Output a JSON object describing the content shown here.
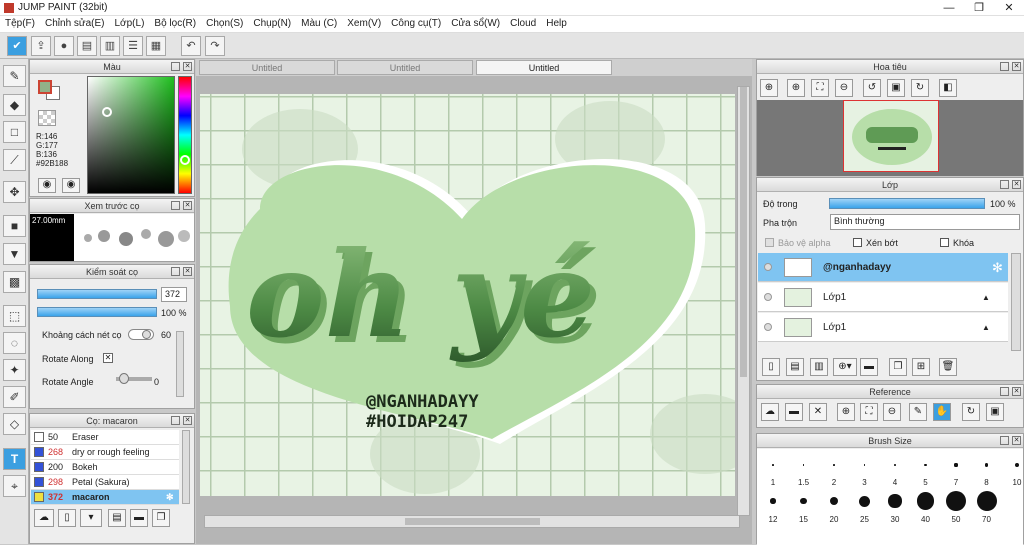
{
  "app": {
    "title": "JUMP PAINT (32bit)"
  },
  "menu": [
    "Tệp(F)",
    "Chỉnh sửa(E)",
    "Lớp(L)",
    "Bộ lọc(R)",
    "Chọn(S)",
    "Chụp(N)",
    "Màu (C)",
    "Xem(V)",
    "Công cụ(T)",
    "Cửa sổ(W)",
    "Cloud",
    "Help"
  ],
  "color_panel": {
    "title": "Màu",
    "r": "R:146",
    "g": "G:177",
    "b": "B:136",
    "hex": "#92B188",
    "main_color": "#92B188"
  },
  "brush_preview": {
    "title": "Xem trước cọ",
    "size": "27.00mm"
  },
  "brush_control": {
    "title": "Kiểm soát cọ",
    "size_value": "372",
    "opacity_value": "100 %",
    "spacing_label": "Khoảng cách nét cọ",
    "spacing_value": "60",
    "rotate_along_label": "Rotate Along",
    "rotate_angle_label": "Rotate Angle",
    "rotate_angle_value": "0"
  },
  "brush_list": {
    "title": "Cọ: macaron",
    "items": [
      {
        "num": "50",
        "name": "Eraser",
        "color": "#ffffff",
        "num_color": "#222222"
      },
      {
        "num": "268",
        "name": "dry or rough feeling",
        "color": "#3352d8",
        "num_color": "#d03030"
      },
      {
        "num": "200",
        "name": "Bokeh",
        "color": "#3352d8",
        "num_color": "#222222"
      },
      {
        "num": "298",
        "name": "Petal (Sakura)",
        "color": "#3352d8",
        "num_color": "#d03030"
      },
      {
        "num": "372",
        "name": "macaron",
        "color": "#f0e040",
        "num_color": "#d03030"
      }
    ]
  },
  "tabs": [
    "Untitled",
    "Untitled",
    "Untitled"
  ],
  "artwork": {
    "main_text": "oh yé",
    "handle": "@NGANHADAYY",
    "tag": "#HOIDAP247"
  },
  "navigator": {
    "title": "Hoa tiêu"
  },
  "layers": {
    "title": "Lớp",
    "opacity_label": "Độ trong",
    "opacity_value": "100 %",
    "blend_label": "Pha trộn",
    "blend_value": "Bình thường",
    "protect_alpha": "Bảo vệ alpha",
    "clipping": "Xén bớt",
    "lock": "Khóa",
    "items": [
      "@nganhadayy",
      "Lớp1",
      "Lớp1"
    ]
  },
  "reference": {
    "title": "Reference"
  },
  "brush_size": {
    "title": "Brush Size",
    "row1": [
      "1",
      "1.5",
      "2",
      "3",
      "4",
      "5",
      "7",
      "8",
      "10"
    ],
    "row2": [
      "12",
      "15",
      "20",
      "25",
      "30",
      "40",
      "50",
      "70"
    ]
  }
}
